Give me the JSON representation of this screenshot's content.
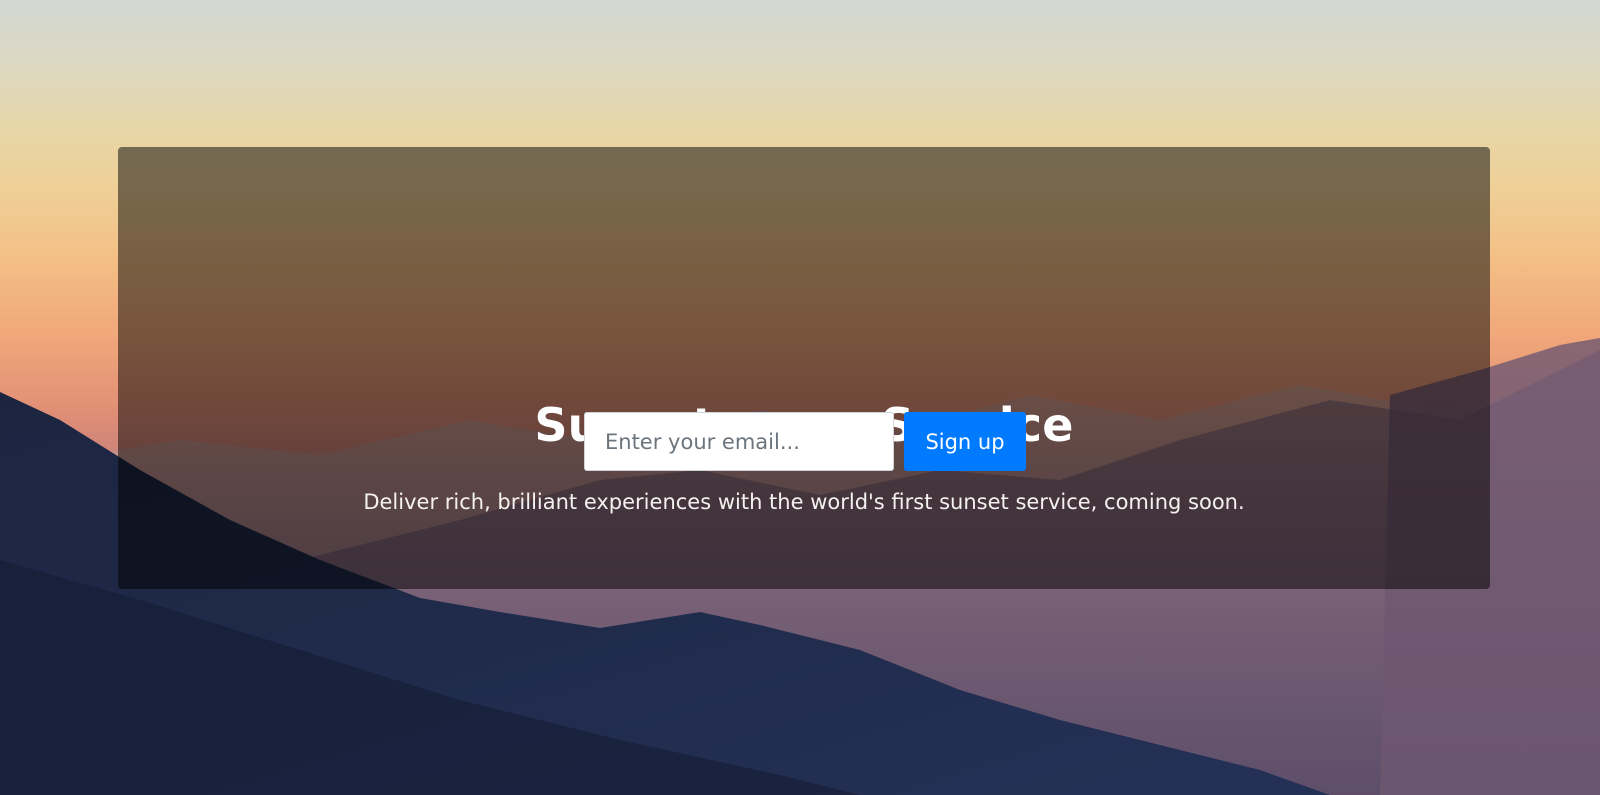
{
  "hero": {
    "title": "Sunsets as a Service",
    "lead": "Deliver rich, brilliant experiences with the world's first sunset service, coming soon."
  },
  "signup": {
    "email_placeholder": "Enter your email...",
    "email_value": "",
    "button_label": "Sign up"
  },
  "colors": {
    "button_primary": "#007bff",
    "overlay": "rgba(0,0,0,0.5)",
    "text_on_dark": "#ffffff"
  }
}
